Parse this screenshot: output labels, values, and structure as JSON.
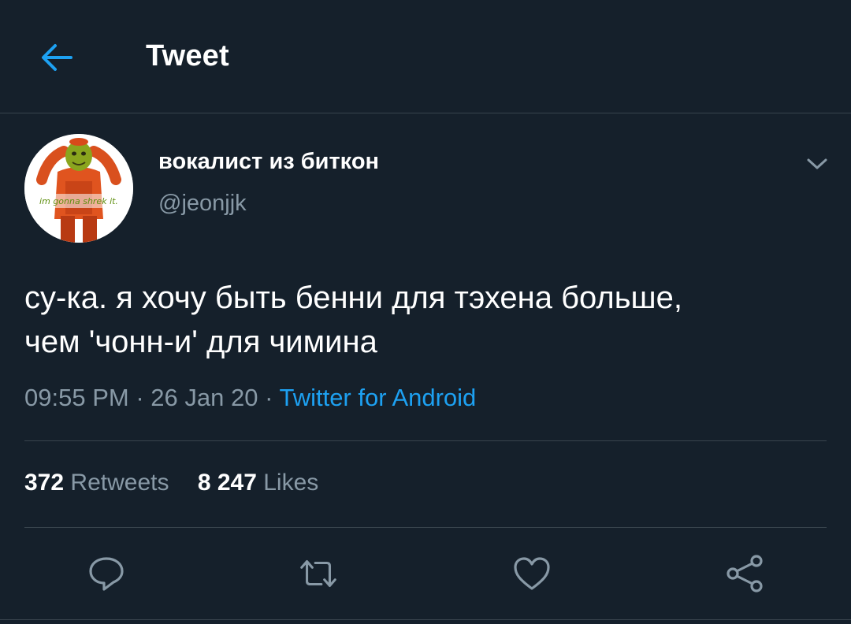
{
  "header": {
    "title": "Tweet",
    "back_icon": "arrow-left-icon"
  },
  "author": {
    "display_name": "вокалист из биткон",
    "handle": "@jeonjjk",
    "avatar_caption": "im gonna shrek it."
  },
  "tweet": {
    "text_line1": "су-ка. я хочу быть бенни для тэхена больше,",
    "text_line2": "чем 'чонн-и' для чимина",
    "time": "09:55 PM",
    "date": "26 Jan 20",
    "separator": "·",
    "source": "Twitter for Android"
  },
  "stats": {
    "retweets_count": "372",
    "retweets_label": "Retweets",
    "likes_count": "8 247",
    "likes_label": "Likes"
  },
  "actions": [
    "reply-icon",
    "retweet-icon",
    "like-icon",
    "share-icon"
  ],
  "colors": {
    "background": "#15202b",
    "accent": "#1da1f2",
    "secondary_text": "#8899a6",
    "divider": "#38444d"
  }
}
